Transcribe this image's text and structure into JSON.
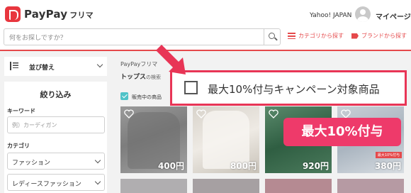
{
  "header": {
    "logo_text": "PayPay",
    "logo_sub": "フリマ",
    "yahoo": "Yahoo! JAPAN",
    "mypage": "マイページ",
    "search_placeholder": "何をお探しですか？",
    "category_link": "カテゴリから探す",
    "brand_link": "ブランドから探す"
  },
  "sidebar": {
    "sort_label": "並び替え",
    "filter_title": "絞り込み",
    "keyword_label": "キーワード",
    "keyword_placeholder": "例）カーディガン",
    "category_label": "カテゴリ",
    "category_1": "ファッション",
    "category_2": "レディースファッション"
  },
  "main": {
    "breadcrumb": "PayPayフリマ",
    "page_title": "トップス",
    "page_title_sub": "の検索",
    "on_sale_label": "販売中の商品"
  },
  "products": [
    {
      "price": "400円",
      "color": "#8a8a8a"
    },
    {
      "price": "800円",
      "color": "#ddd9d2"
    },
    {
      "price": "920円",
      "color": "#3d6e4f"
    },
    {
      "price": "380円",
      "color": "#b9c3cc",
      "badge": "最大10%付与"
    }
  ],
  "annotation": {
    "checkbox_text": "最大10%付与キャンペーン対象商品",
    "badge_text": "最大10%付与"
  },
  "colors": {
    "accent": "#e5494b",
    "highlight": "#e83556",
    "badge_pink": "#ee3a6a",
    "checkbox": "#4fc3c8"
  }
}
